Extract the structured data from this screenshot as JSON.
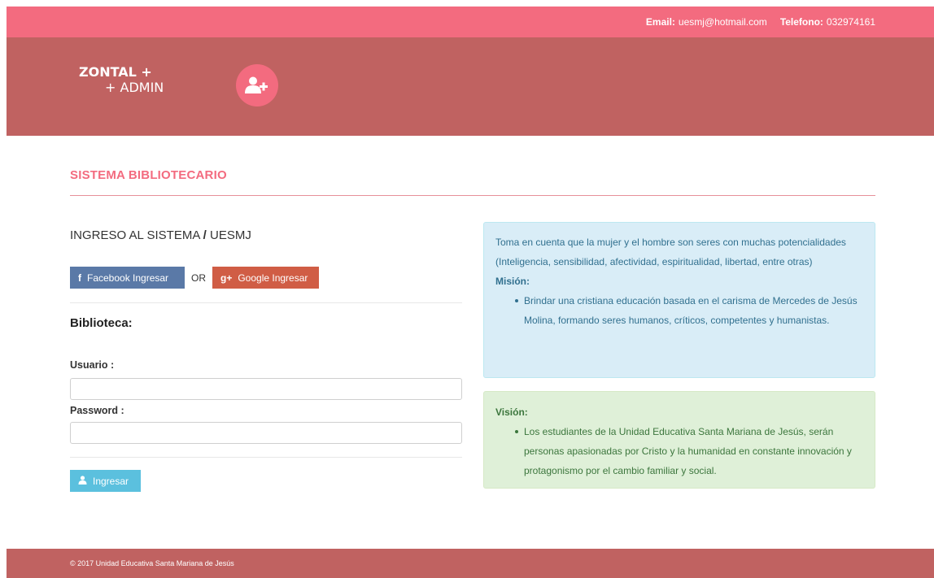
{
  "topbar": {
    "email_label": "Email:",
    "email_value": "uesmj@hotmail.com",
    "phone_label": "Telefono:",
    "phone_value": "032974161"
  },
  "brand": {
    "line1": "ZONTAL +",
    "line2": "+ ADMIN",
    "icon": "add-user-icon"
  },
  "main": {
    "section_title": "SISTEMA BIBLIOTECARIO"
  },
  "login": {
    "heading_part1": "INGRESO AL SISTEMA",
    "heading_sep": "/",
    "heading_part2": "UESMJ",
    "facebook_label": "Facebook Ingresar",
    "or_text": "OR",
    "google_label": "Google Ingresar",
    "biblioteca_label": "Biblioteca:",
    "usuario_label": "Usuario :",
    "usuario_value": "",
    "password_label": "Password :",
    "password_value": "",
    "submit_label": "Ingresar"
  },
  "info": {
    "intro": "Toma en cuenta que la mujer y el hombre son seres con muchas potencialidades (Inteligencia, sensibilidad, afectividad, espiritualidad, libertad, entre otras)",
    "mision_label": "Misión:",
    "mision_text": "Brindar una cristiana educación basada en el carisma de Mercedes de Jesús Molina, formando seres humanos, críticos, competentes y humanistas.",
    "vision_label": "Visión:",
    "vision_text": "Los estudiantes de la Unidad Educativa Santa Mariana de Jesús, serán personas apasionadas por Cristo y la humanidad en constante innovación y protagonismo por el cambio familiar y social."
  },
  "footer": {
    "text": "© 2017 Unidad Educativa Santa Mariana de Jesús"
  },
  "colors": {
    "topbar": "#f36b7f",
    "header": "#c06261",
    "title": "#f36b7f",
    "facebook": "#5a79a7",
    "google": "#d05d45",
    "login_button": "#5bc0de",
    "info_bg": "#d9edf7",
    "vision_bg": "#dff0d8"
  }
}
